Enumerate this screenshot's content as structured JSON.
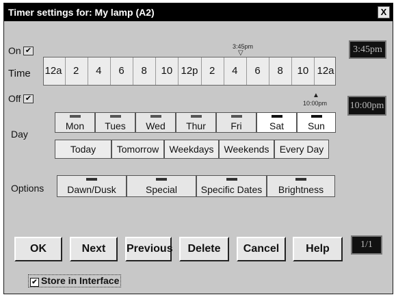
{
  "window": {
    "title": "Timer settings for: My lamp (A2)",
    "close_glyph": "X"
  },
  "on": {
    "label": "On",
    "checked": "✔",
    "time_display": "3:45pm",
    "marker": "3:45pm"
  },
  "off": {
    "label": "Off",
    "checked": "✔",
    "time_display": "10:00pm",
    "marker": "10:00pm"
  },
  "time": {
    "label": "Time",
    "ticks": [
      "12a",
      "2",
      "4",
      "6",
      "8",
      "10",
      "12p",
      "2",
      "4",
      "6",
      "8",
      "10",
      "12a"
    ]
  },
  "day": {
    "label": "Day",
    "days": [
      {
        "label": "Mon",
        "selected": false
      },
      {
        "label": "Tues",
        "selected": false
      },
      {
        "label": "Wed",
        "selected": false
      },
      {
        "label": "Thur",
        "selected": false
      },
      {
        "label": "Fri",
        "selected": false
      },
      {
        "label": "Sat",
        "selected": true
      },
      {
        "label": "Sun",
        "selected": true
      }
    ],
    "presets": [
      "Today",
      "Tomorrow",
      "Weekdays",
      "Weekends",
      "Every Day"
    ]
  },
  "options": {
    "label": "Options",
    "items": [
      "Dawn/Dusk",
      "Special",
      "Specific Dates",
      "Brightness"
    ]
  },
  "actions": {
    "ok": "OK",
    "next": "Next",
    "previous": "Previous",
    "delete": "Delete",
    "cancel": "Cancel",
    "help": "Help"
  },
  "page_indicator": "1/1",
  "store": {
    "checkbox": "✔",
    "label": "Store in Interface"
  }
}
